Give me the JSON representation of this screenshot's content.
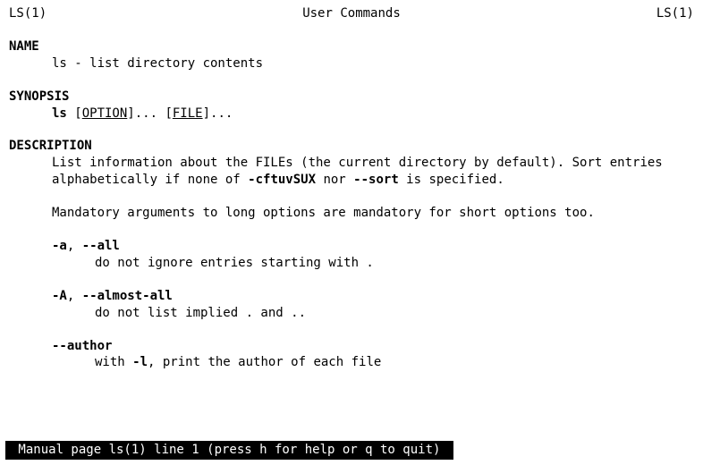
{
  "header": {
    "left": "LS(1)",
    "center": "User Commands",
    "right": "LS(1)"
  },
  "sections": {
    "name": {
      "heading": "NAME",
      "text": "ls - list directory contents"
    },
    "synopsis": {
      "heading": "SYNOPSIS",
      "cmd": "ls",
      "opt_label": "OPTION",
      "file_label": "FILE",
      "after_opt": "]... [",
      "after_file": "]..."
    },
    "description": {
      "heading": "DESCRIPTION",
      "para1_a": "List  information  about  the FILEs (the current directory by default).  Sort entries alphabetically if none of ",
      "para1_flags": "-cftuvSUX",
      "para1_b": " nor ",
      "para1_sort": "--sort",
      "para1_c": " is specified.",
      "para2": "Mandatory arguments to long options are mandatory for short options too.",
      "options": [
        {
          "short": "-a",
          "sep": ", ",
          "long": "--all",
          "desc": "do not ignore entries starting with ."
        },
        {
          "short": "-A",
          "sep": ", ",
          "long": "--almost-all",
          "desc": "do not list implied . and .."
        },
        {
          "short": "",
          "sep": "",
          "long": "--author",
          "desc_a": "with ",
          "desc_flag": "-l",
          "desc_b": ", print the author of each file"
        }
      ]
    }
  },
  "status_bar": " Manual page ls(1) line 1 (press h for help or q to quit) "
}
